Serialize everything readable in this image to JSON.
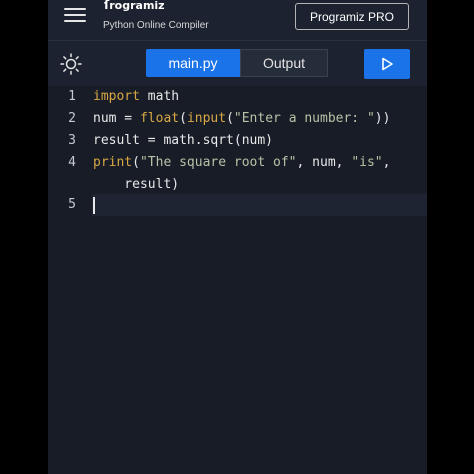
{
  "header": {
    "brand": "rogramiz",
    "subtitle": "Python Online Compiler",
    "pro_label": "Programiz PRO"
  },
  "toolbar": {
    "tabs": [
      {
        "label": "main.py",
        "active": true
      },
      {
        "label": "Output",
        "active": false
      }
    ],
    "run_icon": "play-icon",
    "theme_icon": "sun-icon"
  },
  "editor": {
    "line_numbers": [
      "1",
      "2",
      "3",
      "4",
      "5"
    ],
    "lines": [
      {
        "tokens": [
          {
            "t": "import",
            "c": "kw"
          },
          {
            "t": " math",
            "c": ""
          }
        ]
      },
      {
        "tokens": [
          {
            "t": "num = ",
            "c": ""
          },
          {
            "t": "float",
            "c": "kw"
          },
          {
            "t": "(",
            "c": ""
          },
          {
            "t": "input",
            "c": "kw"
          },
          {
            "t": "(",
            "c": ""
          },
          {
            "t": "\"Enter a number: \"",
            "c": "str"
          },
          {
            "t": "))",
            "c": ""
          }
        ]
      },
      {
        "tokens": [
          {
            "t": "result = math.sqrt(num)",
            "c": ""
          }
        ]
      },
      {
        "tokens": [
          {
            "t": "print",
            "c": "kw"
          },
          {
            "t": "(",
            "c": ""
          },
          {
            "t": "\"The square root of\"",
            "c": "str"
          },
          {
            "t": ", num, ",
            "c": ""
          },
          {
            "t": "\"is\"",
            "c": "str"
          },
          {
            "t": ",",
            "c": ""
          }
        ]
      },
      {
        "tokens": [
          {
            "t": "    result)",
            "c": ""
          }
        ]
      },
      {
        "tokens": []
      }
    ]
  },
  "colors": {
    "accent": "#1a73e8",
    "background": "#171c27",
    "keyword": "#d9a845",
    "string": "#b8c2a6"
  }
}
